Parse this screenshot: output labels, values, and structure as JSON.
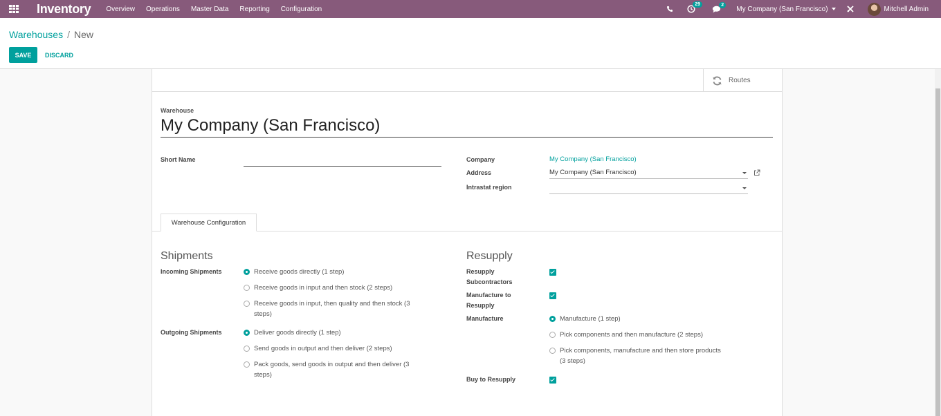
{
  "navbar": {
    "app_title": "Inventory",
    "menu": [
      "Overview",
      "Operations",
      "Master Data",
      "Reporting",
      "Configuration"
    ],
    "activity_count": "29",
    "messages_count": "2",
    "company": "My Company (San Francisco)",
    "user": "Mitchell Admin",
    "colors": {
      "bar": "#875a7b",
      "badge": "#00a09d"
    }
  },
  "breadcrumb": {
    "parent": "Warehouses",
    "separator": "/",
    "current": "New"
  },
  "buttons": {
    "save": "SAVE",
    "discard": "DISCARD"
  },
  "smart_buttons": {
    "routes": "Routes"
  },
  "form": {
    "warehouse_label": "Warehouse",
    "warehouse_name": "My Company (San Francisco)",
    "short_name_label": "Short Name",
    "short_name_value": "",
    "company_label": "Company",
    "company_value": "My Company (San Francisco)",
    "address_label": "Address",
    "address_value": "My Company (San Francisco)",
    "intrastat_label": "Intrastat region",
    "intrastat_value": ""
  },
  "tabs": {
    "active": "Warehouse Configuration"
  },
  "shipments": {
    "title": "Shipments",
    "incoming_label": "Incoming Shipments",
    "incoming_options": [
      {
        "line1": "Receive goods directly (1 step)",
        "line2": "",
        "checked": true
      },
      {
        "line1": "Receive goods in input and then stock (2 steps)",
        "line2": "",
        "checked": false
      },
      {
        "line1": "Receive goods in input, then quality and then stock (3",
        "line2": "steps)",
        "checked": false
      }
    ],
    "outgoing_label": "Outgoing Shipments",
    "outgoing_options": [
      {
        "line1": "Deliver goods directly (1 step)",
        "line2": "",
        "checked": true
      },
      {
        "line1": "Send goods in output and then deliver (2 steps)",
        "line2": "",
        "checked": false
      },
      {
        "line1": "Pack goods, send goods in output and then deliver (3",
        "line2": "steps)",
        "checked": false
      }
    ]
  },
  "resupply": {
    "title": "Resupply",
    "resupply_subcontractors_label_1": "Resupply",
    "resupply_subcontractors_label_2": "Subcontractors",
    "resupply_subcontractors_checked": true,
    "manufacture_to_resupply_label_1": "Manufacture to",
    "manufacture_to_resupply_label_2": "Resupply",
    "manufacture_to_resupply_checked": true,
    "manufacture_label": "Manufacture",
    "manufacture_options": [
      {
        "line1": "Manufacture (1 step)",
        "line2": "",
        "checked": true
      },
      {
        "line1": "Pick components and then manufacture (2 steps)",
        "line2": "",
        "checked": false
      },
      {
        "line1": "Pick components, manufacture and then store products",
        "line2": "(3 steps)",
        "checked": false
      }
    ],
    "buy_to_resupply_label": "Buy to Resupply",
    "buy_to_resupply_checked": true
  }
}
